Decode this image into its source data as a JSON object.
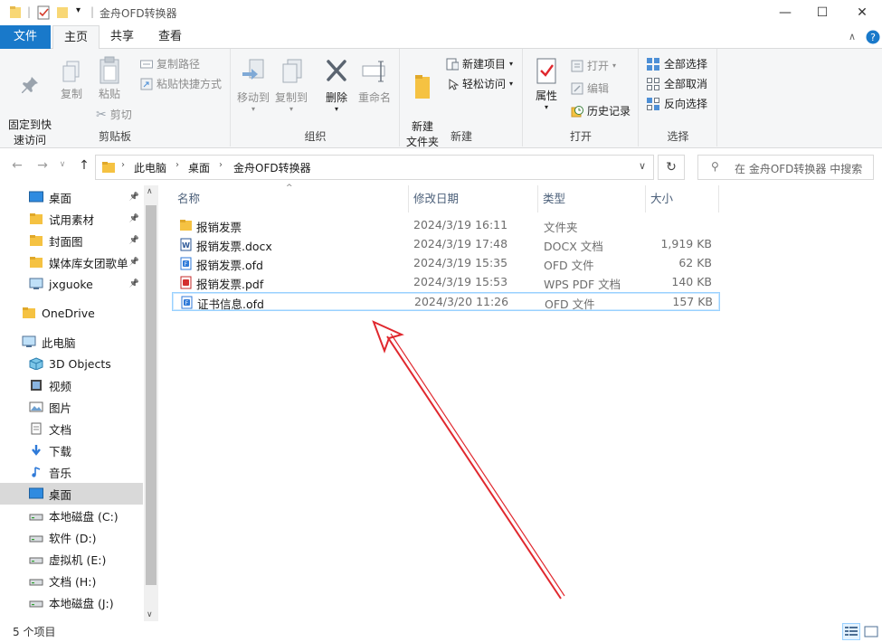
{
  "window": {
    "title": "金舟OFD转换器",
    "minimize_glyph": "—",
    "maximize_glyph": "☐",
    "close_glyph": "✕"
  },
  "ribbon_tabs": [
    "文件",
    "主页",
    "共享",
    "查看"
  ],
  "ribbon": {
    "clipboard": {
      "label": "剪贴板",
      "pin": "固定到快\n速访问",
      "copy": "复制",
      "paste": "粘贴",
      "copy_path": "复制路径",
      "paste_shortcut": "粘贴快捷方式",
      "cut": "剪切"
    },
    "organize": {
      "label": "组织",
      "move_to": "移动到",
      "copy_to": "复制到",
      "delete": "删除",
      "rename": "重命名"
    },
    "new": {
      "label": "新建",
      "new_folder": "新建\n文件夹",
      "new_item": "新建项目",
      "easy_access": "轻松访问"
    },
    "open": {
      "label": "打开",
      "properties": "属性",
      "open": "打开",
      "edit": "编辑",
      "history": "历史记录"
    },
    "select": {
      "label": "选择",
      "select_all": "全部选择",
      "select_none": "全部取消",
      "invert": "反向选择"
    }
  },
  "address": {
    "crumbs": [
      "此电脑",
      "桌面",
      "金舟OFD转换器"
    ],
    "search_placeholder": "在 金舟OFD转换器 中搜索"
  },
  "nav_pane": {
    "quick_access": [
      {
        "label": "桌面",
        "icon": "desktop-icon",
        "pinned": true
      },
      {
        "label": "试用素材",
        "icon": "folder-icon",
        "pinned": true
      },
      {
        "label": "封面图",
        "icon": "folder-icon",
        "pinned": true
      },
      {
        "label": "媒体库女团歌单",
        "icon": "folder-icon",
        "pinned": true
      },
      {
        "label": "jxguoke",
        "icon": "computer-icon",
        "pinned": true
      }
    ],
    "onedrive": "OneDrive",
    "this_pc": "此电脑",
    "pc_items": [
      {
        "label": "3D Objects",
        "icon": "cube-icon"
      },
      {
        "label": "视频",
        "icon": "video-icon"
      },
      {
        "label": "图片",
        "icon": "picture-icon"
      },
      {
        "label": "文档",
        "icon": "document-icon"
      },
      {
        "label": "下载",
        "icon": "download-icon"
      },
      {
        "label": "音乐",
        "icon": "music-icon"
      },
      {
        "label": "桌面",
        "icon": "desktop-icon",
        "selected": true
      },
      {
        "label": "本地磁盘 (C:)",
        "icon": "drive-icon"
      },
      {
        "label": "软件 (D:)",
        "icon": "drive-icon"
      },
      {
        "label": "虚拟机 (E:)",
        "icon": "drive-icon"
      },
      {
        "label": "文档 (H:)",
        "icon": "drive-icon"
      },
      {
        "label": "本地磁盘 (J:)",
        "icon": "drive-icon"
      }
    ]
  },
  "file_list": {
    "columns": [
      "名称",
      "修改日期",
      "类型",
      "大小"
    ],
    "files": [
      {
        "name": "报销发票",
        "date": "2024/3/19 16:11",
        "type": "文件夹",
        "size": "",
        "icon": "folder-icon"
      },
      {
        "name": "报销发票.docx",
        "date": "2024/3/19 17:48",
        "type": "DOCX 文档",
        "size": "1,919 KB",
        "icon": "word-icon"
      },
      {
        "name": "报销发票.ofd",
        "date": "2024/3/19 15:35",
        "type": "OFD 文件",
        "size": "62 KB",
        "icon": "ofd-icon"
      },
      {
        "name": "报销发票.pdf",
        "date": "2024/3/19 15:53",
        "type": "WPS PDF 文档",
        "size": "140 KB",
        "icon": "pdf-icon"
      },
      {
        "name": "证书信息.ofd",
        "date": "2024/3/20 11:26",
        "type": "OFD 文件",
        "size": "157 KB",
        "icon": "ofd-icon",
        "selected": true
      }
    ]
  },
  "status": {
    "item_count": "5 个项目"
  },
  "colors": {
    "accent": "#1979ca",
    "selection_border": "#99d1ff",
    "annotation_arrow": "#e0282e"
  }
}
